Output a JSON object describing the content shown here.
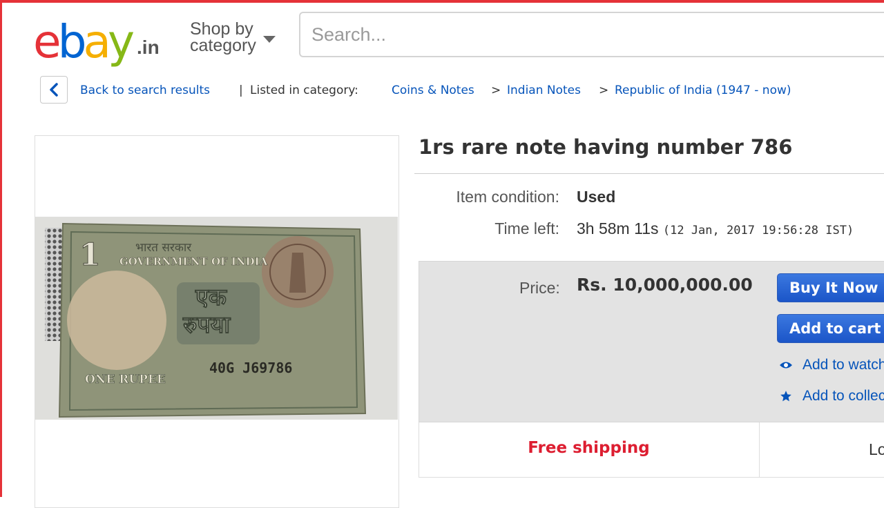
{
  "header": {
    "logo": {
      "e": "e",
      "b": "b",
      "a": "a",
      "y": "y",
      "tld": ".in"
    },
    "shop_by": "Shop by category",
    "search_placeholder": "Search..."
  },
  "breadcrumb": {
    "back": "Back to search results",
    "separator": "|",
    "listed_in": "Listed in category:",
    "items": [
      "Coins & Notes",
      "Indian Notes",
      "Republic of India (1947 - now)"
    ],
    "arrow": ">"
  },
  "item": {
    "title": "1rs rare note having number 786",
    "condition_label": "Item condition:",
    "condition_value": "Used",
    "time_left_label": "Time left:",
    "time_left_value": "3h 58m 11s",
    "time_left_detail": "(12 Jan, 2017  19:56:28 IST)",
    "price_label": "Price:",
    "price_value": "Rs. 10,000,000.00"
  },
  "actions": {
    "buy_now": "Buy It Now",
    "add_to_cart": "Add to cart",
    "add_to_watch": "Add to watch",
    "add_to_collection": "Add to collec"
  },
  "shipping": {
    "free": "Free shipping",
    "right_partial": "Lo"
  },
  "note_image": {
    "top_text": "GOVERNMENT OF INDIA",
    "hindi_top": "भारत सरकार",
    "hindi_center_1": "एक",
    "hindi_center_2": "रुपया",
    "numeral": "1",
    "bottom_text": "ONE RUPEE",
    "serial": "40G  J69786"
  },
  "colors": {
    "logo_e": "#e53238",
    "logo_b": "#0064d2",
    "logo_a": "#f5af02",
    "logo_y": "#86b817",
    "link": "#0654ba",
    "button": "#1b55c8",
    "free_shipping": "#dd1e31",
    "frame": "#e53238"
  },
  "icons": [
    "chevron-left-icon",
    "caret-down-icon",
    "eye-icon",
    "star-icon"
  ]
}
